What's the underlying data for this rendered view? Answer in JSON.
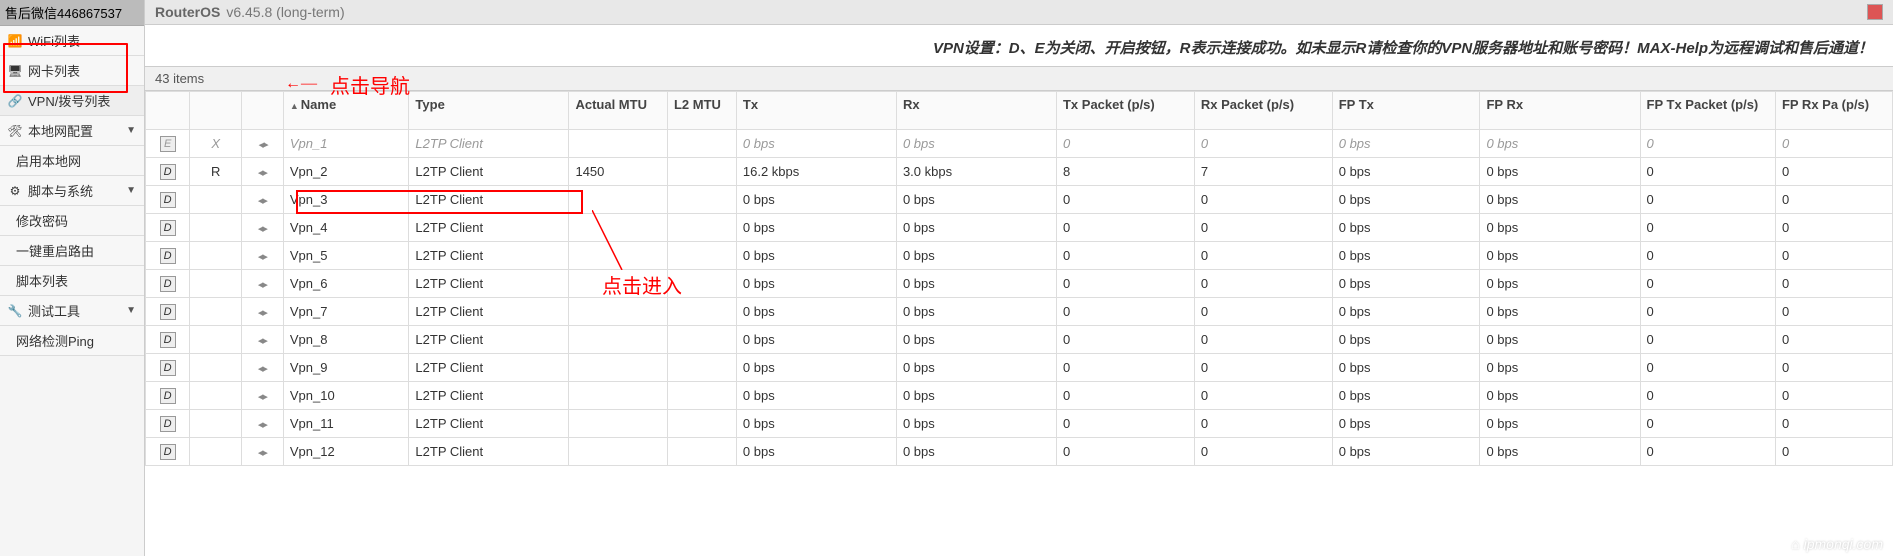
{
  "sidebar": {
    "top": "售后微信446867537",
    "items": [
      {
        "icon": "📶",
        "label": "WiFi列表",
        "expand": false
      },
      {
        "icon": "🖥",
        "label": "网卡列表",
        "expand": false
      },
      {
        "icon": "🔗",
        "label": "VPN/拨号列表",
        "expand": false,
        "selected": true
      },
      {
        "icon": "🛠",
        "label": "本地网配置",
        "expand": true
      },
      {
        "icon": "",
        "label": "启用本地网",
        "indent": true
      },
      {
        "icon": "⚙",
        "label": "脚本与系统",
        "expand": true
      },
      {
        "icon": "",
        "label": "修改密码",
        "indent": true
      },
      {
        "icon": "",
        "label": "一键重启路由",
        "indent": true
      },
      {
        "icon": "",
        "label": "脚本列表",
        "indent": true
      },
      {
        "icon": "🔧",
        "label": "测试工具",
        "expand": true
      },
      {
        "icon": "",
        "label": "网络检测Ping",
        "indent": true
      }
    ]
  },
  "titlebar": {
    "product": "RouterOS",
    "version": "v6.45.8 (long-term)"
  },
  "banner": "VPN设置：D、E为关闭、开启按钮，R表示连接成功。如未显示R请检查你的VPN服务器地址和账号密码！MAX-Help为远程调试和售后通道！",
  "count_label": "43 items",
  "annotations": {
    "nav_arrow": "←—",
    "nav_text": "点击导航",
    "enter_text": "点击进入"
  },
  "watermark": "⌂ ipmonqi.com",
  "columns": [
    "",
    "",
    "",
    "Name",
    "Type",
    "Actual MTU",
    "L2 MTU",
    "Tx",
    "Rx",
    "Tx Packet (p/s)",
    "Rx Packet (p/s)",
    "FP Tx",
    "FP Rx",
    "FP Tx Packet (p/s)",
    "FP Rx Pa (p/s)"
  ],
  "rows": [
    {
      "flag": "E",
      "status": "X",
      "name": "Vpn_1",
      "type": "L2TP Client",
      "mtu": "",
      "l2": "",
      "tx": "0 bps",
      "rx": "0 bps",
      "txp": "0",
      "rxp": "0",
      "fptx": "0 bps",
      "fprx": "0 bps",
      "fptxp": "0",
      "fprxp": "0",
      "disabled": true
    },
    {
      "flag": "D",
      "status": "R",
      "name": "Vpn_2",
      "type": "L2TP Client",
      "mtu": "1450",
      "l2": "",
      "tx": "16.2 kbps",
      "rx": "3.0 kbps",
      "txp": "8",
      "rxp": "7",
      "fptx": "0 bps",
      "fprx": "0 bps",
      "fptxp": "0",
      "fprxp": "0"
    },
    {
      "flag": "D",
      "status": "",
      "name": "Vpn_3",
      "type": "L2TP Client",
      "mtu": "",
      "l2": "",
      "tx": "0 bps",
      "rx": "0 bps",
      "txp": "0",
      "rxp": "0",
      "fptx": "0 bps",
      "fprx": "0 bps",
      "fptxp": "0",
      "fprxp": "0"
    },
    {
      "flag": "D",
      "status": "",
      "name": "Vpn_4",
      "type": "L2TP Client",
      "mtu": "",
      "l2": "",
      "tx": "0 bps",
      "rx": "0 bps",
      "txp": "0",
      "rxp": "0",
      "fptx": "0 bps",
      "fprx": "0 bps",
      "fptxp": "0",
      "fprxp": "0"
    },
    {
      "flag": "D",
      "status": "",
      "name": "Vpn_5",
      "type": "L2TP Client",
      "mtu": "",
      "l2": "",
      "tx": "0 bps",
      "rx": "0 bps",
      "txp": "0",
      "rxp": "0",
      "fptx": "0 bps",
      "fprx": "0 bps",
      "fptxp": "0",
      "fprxp": "0"
    },
    {
      "flag": "D",
      "status": "",
      "name": "Vpn_6",
      "type": "L2TP Client",
      "mtu": "",
      "l2": "",
      "tx": "0 bps",
      "rx": "0 bps",
      "txp": "0",
      "rxp": "0",
      "fptx": "0 bps",
      "fprx": "0 bps",
      "fptxp": "0",
      "fprxp": "0"
    },
    {
      "flag": "D",
      "status": "",
      "name": "Vpn_7",
      "type": "L2TP Client",
      "mtu": "",
      "l2": "",
      "tx": "0 bps",
      "rx": "0 bps",
      "txp": "0",
      "rxp": "0",
      "fptx": "0 bps",
      "fprx": "0 bps",
      "fptxp": "0",
      "fprxp": "0"
    },
    {
      "flag": "D",
      "status": "",
      "name": "Vpn_8",
      "type": "L2TP Client",
      "mtu": "",
      "l2": "",
      "tx": "0 bps",
      "rx": "0 bps",
      "txp": "0",
      "rxp": "0",
      "fptx": "0 bps",
      "fprx": "0 bps",
      "fptxp": "0",
      "fprxp": "0"
    },
    {
      "flag": "D",
      "status": "",
      "name": "Vpn_9",
      "type": "L2TP Client",
      "mtu": "",
      "l2": "",
      "tx": "0 bps",
      "rx": "0 bps",
      "txp": "0",
      "rxp": "0",
      "fptx": "0 bps",
      "fprx": "0 bps",
      "fptxp": "0",
      "fprxp": "0"
    },
    {
      "flag": "D",
      "status": "",
      "name": "Vpn_10",
      "type": "L2TP Client",
      "mtu": "",
      "l2": "",
      "tx": "0 bps",
      "rx": "0 bps",
      "txp": "0",
      "rxp": "0",
      "fptx": "0 bps",
      "fprx": "0 bps",
      "fptxp": "0",
      "fprxp": "0"
    },
    {
      "flag": "D",
      "status": "",
      "name": "Vpn_11",
      "type": "L2TP Client",
      "mtu": "",
      "l2": "",
      "tx": "0 bps",
      "rx": "0 bps",
      "txp": "0",
      "rxp": "0",
      "fptx": "0 bps",
      "fprx": "0 bps",
      "fptxp": "0",
      "fprxp": "0"
    },
    {
      "flag": "D",
      "status": "",
      "name": "Vpn_12",
      "type": "L2TP Client",
      "mtu": "",
      "l2": "",
      "tx": "0 bps",
      "rx": "0 bps",
      "txp": "0",
      "rxp": "0",
      "fptx": "0 bps",
      "fprx": "0 bps",
      "fptxp": "0",
      "fprxp": "0"
    }
  ]
}
